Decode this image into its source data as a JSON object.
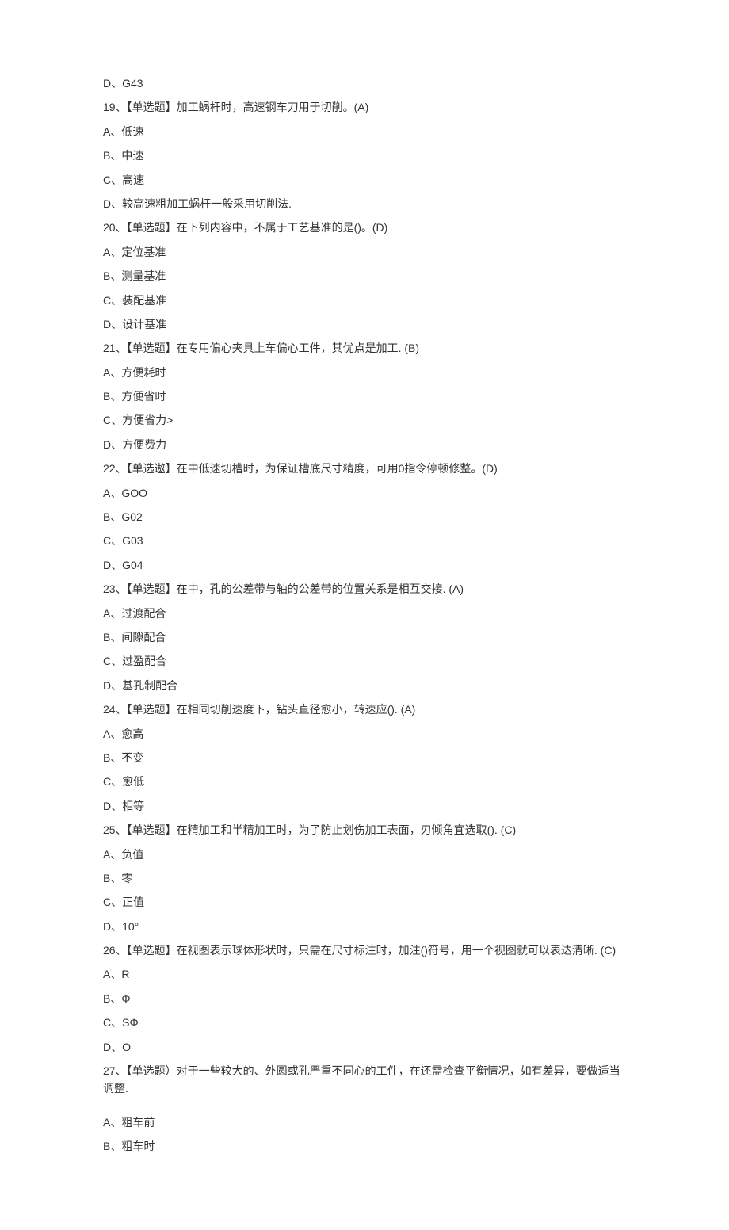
{
  "lines": [
    "D、G43",
    "19、【单选题】加工蜗杆时，高速钢车刀用于切削。(A)",
    "A、低速",
    "B、中速",
    "C、高速",
    "D、较高速粗加工蜗杆一般采用切削法.",
    "20、【单选题】在下列内容中，不属于工艺基准的是()。(D)",
    "A、定位基准",
    "B、测量基准",
    "C、装配基准",
    "D、设计基准",
    "21、【单选题】在专用偏心夹具上车偏心工件，其优点是加工. (B)",
    "A、方便耗时",
    "B、方便省时",
    "C、方便省力>",
    "D、方便费力",
    "22、【单选遨】在中低速切槽时，为保证槽底尺寸精度，可用0指令停顿修整。(D)",
    "A、GOO",
    "B、G02",
    "C、G03",
    "D、G04",
    "23、【单选题】在中，孔的公差带与轴的公差带的位置关系是相互交接. (A)",
    "A、过渡配合",
    "B、间隙配合",
    "C、过盈配合",
    "D、基孔制配合",
    "24、【单选题】在相同切削速度下，钻头直径愈小，转速应(). (A)",
    "A、愈高",
    "B、不变",
    "C、愈低",
    "D、相等",
    "25、【单选题】在精加工和半精加工时，为了防止划伤加工表面，刃倾角宜选取(). (C)",
    "A、负值",
    "B、零",
    "C、正值",
    "D、10°",
    "26、【单选题】在视图表示球体形状时，只需在尺寸标注时，加注()符号，用一个视图就可以表达清晰. (C)",
    "A、R",
    "B、Φ",
    "C、SΦ",
    "D、O",
    "27、【单选题）对于一些较大的、外圆或孔严重不同心的工件，在还需检查平衡情况，如有差异，要做适当调整.",
    "",
    "A、粗车前",
    "B、粗车时"
  ]
}
